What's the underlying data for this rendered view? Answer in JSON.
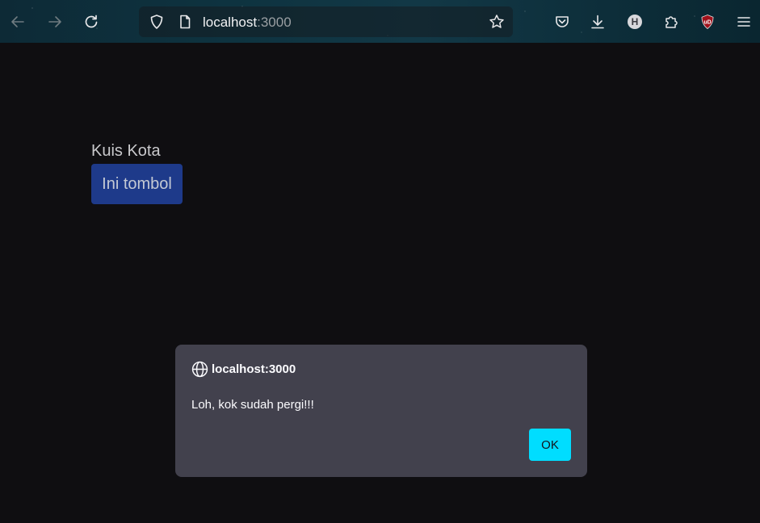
{
  "browser": {
    "url_host": "localhost",
    "url_port": ":3000",
    "icons": {
      "back": "arrow-left-icon",
      "forward": "arrow-right-icon",
      "reload": "reload-icon",
      "shield": "shield-icon",
      "page": "page-icon",
      "bookmark": "star-icon",
      "pocket": "pocket-icon",
      "downloads": "download-icon",
      "account": "account-avatar-icon",
      "extensions": "puzzle-icon",
      "ublock": "ublock-icon",
      "menu": "hamburger-menu-icon"
    },
    "account_letter": "H",
    "ublock_text": "uD",
    "ublock_color": "#a0111b",
    "toolbar_color": "#0e3340"
  },
  "page": {
    "title": "Kuis Kota",
    "button_label": "Ini tombol",
    "button_color": "#1e3a8a",
    "background_color": "#0f0e11"
  },
  "dialog": {
    "origin": "localhost:3000",
    "message": "Loh, kok sudah pergi!!!",
    "ok_label": "OK",
    "ok_color": "#00ddff",
    "background_color": "#42414d"
  }
}
